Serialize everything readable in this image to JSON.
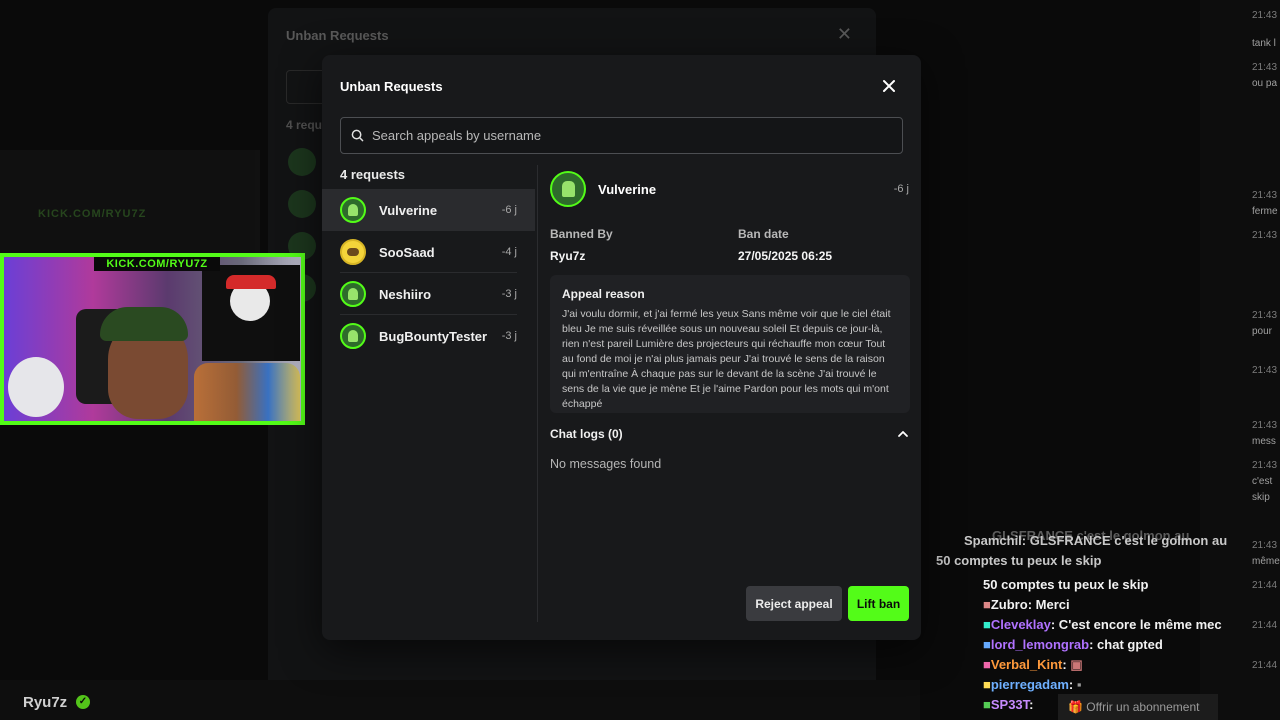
{
  "colors": {
    "accent": "#53fc18",
    "modal_bg": "#18191b",
    "panel_bg": "#202124"
  },
  "background": {
    "dialog_title": "Unban Requests",
    "dialog_count": "4 requ",
    "streamer_name": "Ryu7z",
    "cam_banner": "KICK.COM/RYU7Z",
    "ghost_banner": "KICK.COM/RYU7Z",
    "right_timestamps": [
      "21:43",
      "21:43",
      "21:43",
      "21:43",
      "21:43",
      "21:43",
      "21:43",
      "21:43",
      "21:43",
      "21:43",
      "21:44",
      "21:44",
      "21:44"
    ],
    "right_snippets": [
      "tank l",
      "ou pa",
      "ferme",
      "pour",
      "mess",
      "c'est",
      "skip",
      "même"
    ]
  },
  "modal": {
    "title": "Unban Requests",
    "search_placeholder": "Search appeals by username",
    "count_label": "4 requests",
    "requests": [
      {
        "name": "Vulverine",
        "ago": "-6 j",
        "avatar": "kick-icon"
      },
      {
        "name": "SooSaad",
        "ago": "-4 j",
        "avatar": "pikachu-icon"
      },
      {
        "name": "Neshiiro",
        "ago": "-3 j",
        "avatar": "kick-icon"
      },
      {
        "name": "BugBountyTester",
        "ago": "-3 j",
        "avatar": "kick-icon"
      }
    ],
    "detail": {
      "name": "Vulverine",
      "ago": "-6 j",
      "banned_by_label": "Banned By",
      "banned_by_value": "Ryu7z",
      "ban_date_label": "Ban date",
      "ban_date_value": "27/05/2025 06:25",
      "appeal_label": "Appeal reason",
      "appeal_text": "J'ai voulu dormir, et j'ai fermé les yeux Sans même voir que le ciel était bleu Je me suis réveillée sous un nouveau soleil Et depuis ce jour-là, rien n'est pareil Lumière des projecteurs qui réchauffe mon cœur Tout au fond de moi je n'ai plus jamais peur J'ai trouvé le sens de la raison qui m'entraîne À chaque pas sur le devant de la scène J'ai trouvé le sens de la vie que je mène Et je l'aime Pardon pour les mots qui m'ont échappé",
      "chat_logs_label": "Chat logs (0)",
      "no_messages": "No messages found"
    },
    "buttons": {
      "reject": "Reject appeal",
      "lift": "Lift ban"
    }
  },
  "chat_overlay": {
    "ghost_lines": [
      "GLSFRANCE c'est le golmon au",
      "Spamchil: GLSFRANCE c'est le golmon au",
      "50 comptes tu peux le skip"
    ],
    "lines": [
      {
        "user": "",
        "text": "50 comptes tu peux le skip",
        "color": "#f2f2f2"
      },
      {
        "user": "Zubro",
        "text": ": Merci",
        "color": "#f2f2f2"
      },
      {
        "user": "Cleveklay",
        "text": ": C'est encore le même mec",
        "color": "#b072ff"
      },
      {
        "user": "lord_lemongrab",
        "text": ": chat gpted",
        "color": "#b072ff"
      },
      {
        "user": "Verbal_Kint",
        "text": ":",
        "color": "#ff9a3c"
      },
      {
        "user": "pierregadam",
        "text": ":",
        "color": "#6fb0ff"
      },
      {
        "user": "SP33T",
        "text": ":",
        "color": "#c78bff"
      }
    ],
    "subscribe_label": "Offrir un abonnement"
  }
}
